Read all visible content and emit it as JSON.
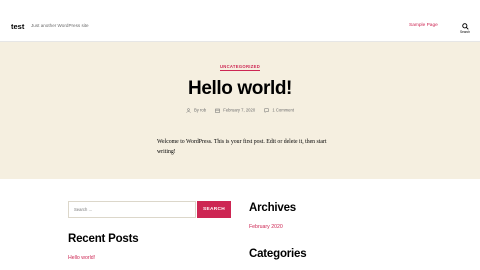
{
  "header": {
    "site_title": "test",
    "site_description": "Just another WordPress site",
    "nav_items": [
      "Sample Page"
    ],
    "search_label": "Search"
  },
  "post": {
    "category": "UNCATEGORIZED",
    "title": "Hello world!",
    "author": "By rob",
    "date": "February 7, 2020",
    "comments": "1 Comment",
    "content": "Welcome to WordPress. This is your first post. Edit or delete it, then start writing!"
  },
  "sidebar": {
    "search_placeholder": "Search …",
    "search_button": "SEARCH",
    "recent_posts_heading": "Recent Posts",
    "recent_posts": [
      "Hello world!"
    ],
    "archives_heading": "Archives",
    "archives": [
      "February 2020"
    ],
    "categories_heading": "Categories"
  },
  "colors": {
    "accent": "#cd2653",
    "hero_background": "#f5efe0",
    "secondary_text": "#6d6d6d"
  }
}
